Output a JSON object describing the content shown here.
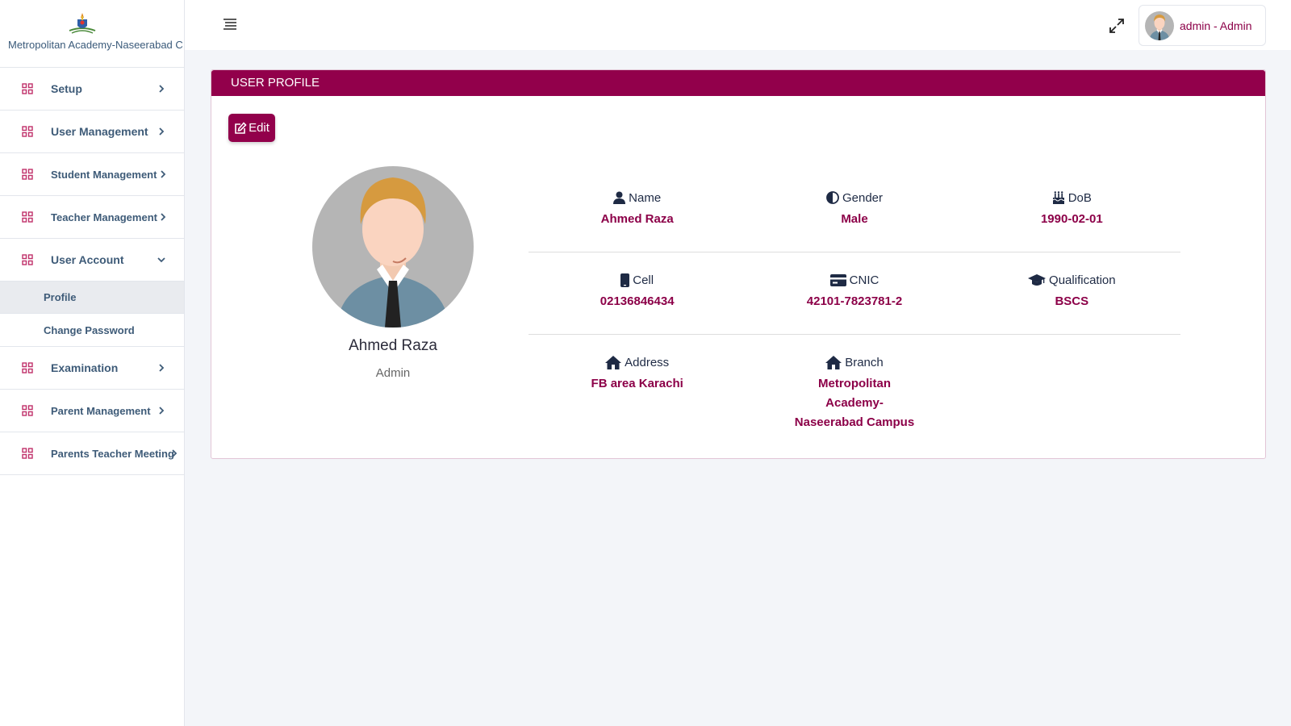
{
  "sidebar": {
    "brand_text": "Metropolitan Academy-Naseerabad C",
    "items": [
      {
        "label": "Setup"
      },
      {
        "label": "User Management"
      },
      {
        "label": "Student Management"
      },
      {
        "label": "Teacher Management"
      },
      {
        "label": "User Account"
      },
      {
        "label": "Examination"
      },
      {
        "label": "Parent Management"
      },
      {
        "label": "Parents Teacher Meeting"
      }
    ],
    "submenu": [
      {
        "label": "Profile"
      },
      {
        "label": "Change Password"
      }
    ]
  },
  "topbar": {
    "user_label": "admin - Admin"
  },
  "card": {
    "title": "USER PROFILE",
    "edit_label": "Edit"
  },
  "profile": {
    "name": "Ahmed Raza",
    "role": "Admin"
  },
  "details": {
    "name": {
      "label": "Name",
      "value": "Ahmed Raza"
    },
    "gender": {
      "label": "Gender",
      "value": "Male"
    },
    "dob": {
      "label": "DoB",
      "value": "1990-02-01"
    },
    "cell": {
      "label": "Cell",
      "value": "02136846434"
    },
    "cnic": {
      "label": "CNIC",
      "value": "42101-7823781-2"
    },
    "qualification": {
      "label": "Qualification",
      "value": "BSCS"
    },
    "address": {
      "label": "Address",
      "value": "FB area Karachi"
    },
    "branch": {
      "label": "Branch",
      "value": "Metropolitan Academy-Naseerabad Campus"
    }
  },
  "colors": {
    "accent": "#92004b",
    "nav_text": "#3e5b78"
  },
  "icons": {
    "menu": "grid-icon",
    "chevron": "chevron-right-icon"
  }
}
